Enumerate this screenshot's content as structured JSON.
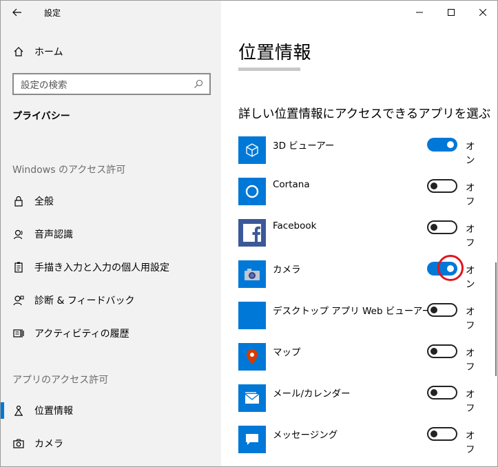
{
  "window": {
    "app_title": "設定",
    "controls": {
      "minimize": "minimize-icon",
      "maximize": "maximize-icon",
      "close": "close-icon"
    }
  },
  "sidebar": {
    "home_label": "ホーム",
    "search_placeholder": "設定の検索",
    "section_title": "プライバシー",
    "group_windows": "Windows のアクセス許可",
    "windows_items": [
      {
        "label": "全般",
        "icon": "lock-icon"
      },
      {
        "label": "音声認識",
        "icon": "speech-icon"
      },
      {
        "label": "手描き入力と入力の個人用設定",
        "icon": "inking-icon"
      },
      {
        "label": "診断 & フィードバック",
        "icon": "feedback-icon"
      },
      {
        "label": "アクティビティの履歴",
        "icon": "activity-icon"
      }
    ],
    "group_apps": "アプリのアクセス許可",
    "app_items": [
      {
        "label": "位置情報",
        "icon": "location-icon",
        "selected": true
      },
      {
        "label": "カメラ",
        "icon": "camera-icon",
        "selected": false
      }
    ]
  },
  "main": {
    "page_title": "位置情報",
    "subheading": "詳しい位置情報にアクセスできるアプリを選ぶ",
    "on_label": "オン",
    "off_label": "オフ",
    "accent_color": "#0078d7",
    "apps": [
      {
        "name": "3D ビューアー",
        "icon": "cube-icon",
        "state": "on",
        "state_label": "オン"
      },
      {
        "name": "Cortana",
        "icon": "cortana-circle-icon",
        "state": "off",
        "state_label": "オフ"
      },
      {
        "name": "Facebook",
        "icon": "facebook-icon",
        "state": "off",
        "state_label": "オフ"
      },
      {
        "name": "カメラ",
        "icon": "camera-icon",
        "state": "on",
        "state_label": "オン",
        "highlighted": true
      },
      {
        "name": "デスクトップ アプリ Web ビューアー",
        "icon": "blank-tile",
        "state": "off",
        "state_label": "オフ"
      },
      {
        "name": "マップ",
        "icon": "map-pin-icon",
        "state": "off",
        "state_label": "オフ"
      },
      {
        "name": "メール/カレンダー",
        "icon": "mail-icon",
        "state": "off",
        "state_label": "オフ"
      },
      {
        "name": "メッセージング",
        "icon": "message-icon",
        "state": "off",
        "state_label": "オフ"
      }
    ]
  }
}
